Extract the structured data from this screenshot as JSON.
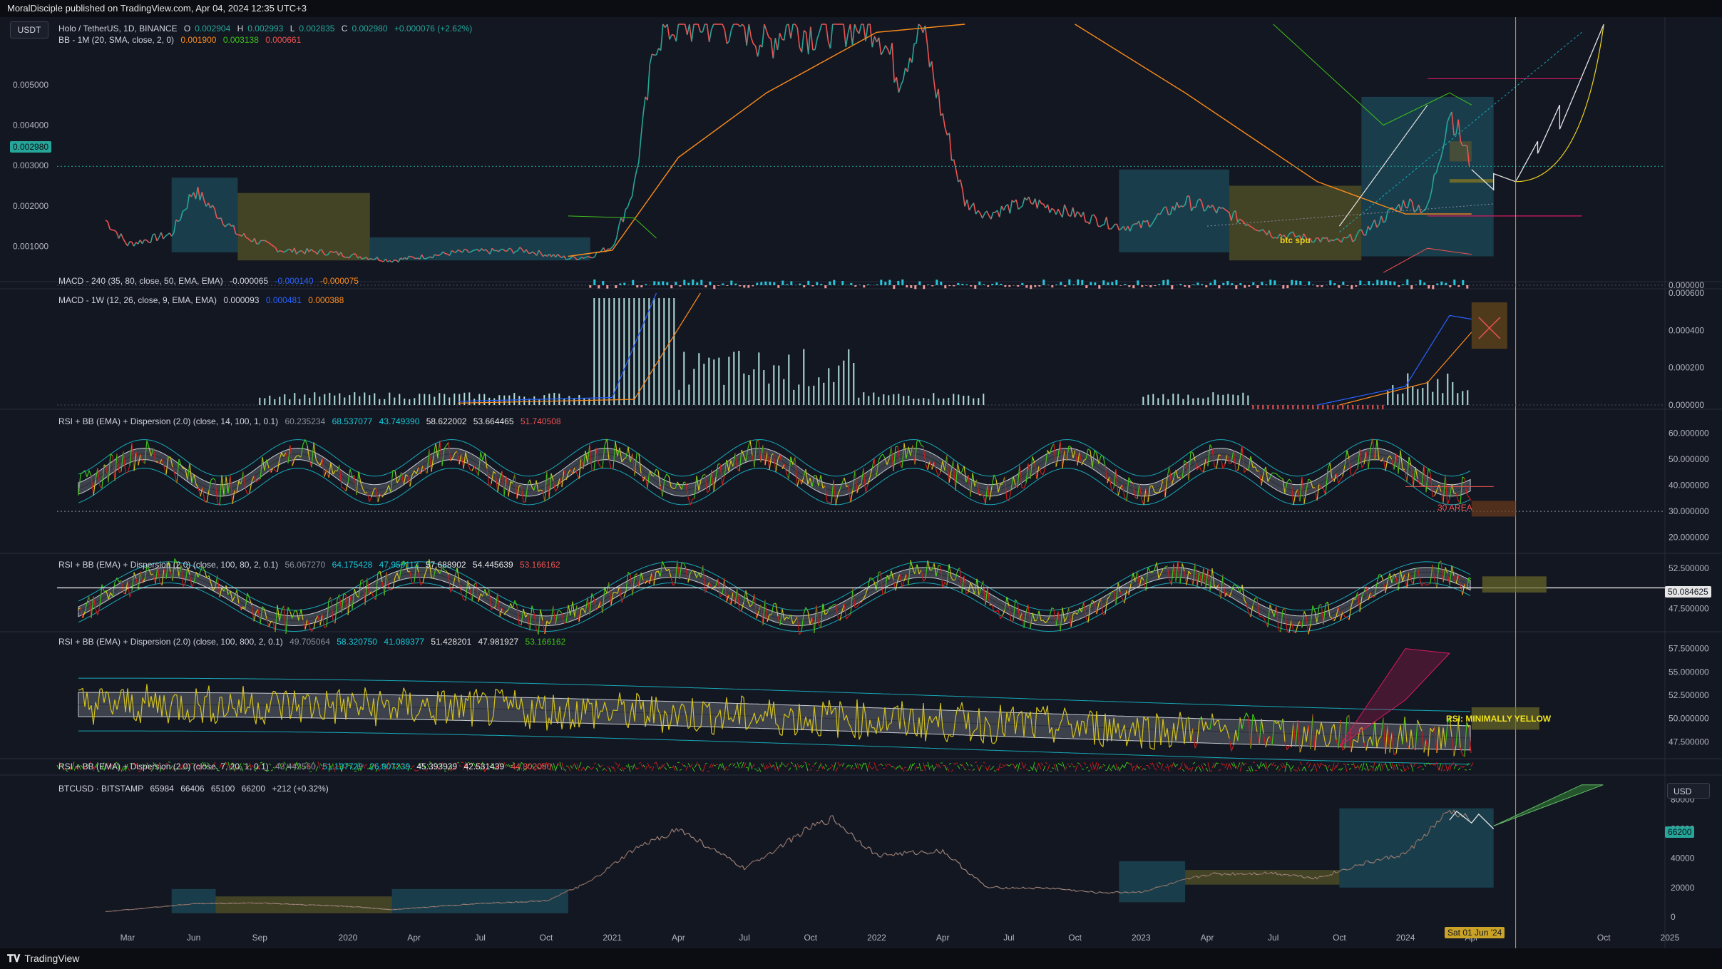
{
  "header": {
    "publisher": "MoralDisciple published on TradingView.com, Apr 04, 2024 12:35 UTC+3"
  },
  "footer": {
    "brand": "TradingView"
  },
  "currency_button": "USDT",
  "btc_currency_button": "USD",
  "legends": {
    "main": {
      "symbol": "Holo / TetherUS, 1D, BINANCE",
      "o_label": "O",
      "o": "0.002904",
      "h_label": "H",
      "h": "0.002993",
      "l_label": "L",
      "l": "0.002835",
      "c_label": "C",
      "c": "0.002980",
      "change": "+0.000076 (+2.62%)"
    },
    "bb": {
      "name": "BB - 1M (20, SMA, close, 2, 0)",
      "v1": "0.001900",
      "v2": "0.003138",
      "v3": "0.000661"
    },
    "macd240": {
      "name": "MACD - 240 (35, 80, close, 50, EMA, EMA)",
      "v1": "-0.000065",
      "v2": "-0.000140",
      "v3": "-0.000075"
    },
    "macd1w": {
      "name": "MACD - 1W (12, 26, close, 9, EMA, EMA)",
      "v1": "0.000093",
      "v2": "0.000481",
      "v3": "0.000388"
    },
    "rsi1": {
      "name": "RSI + BB (EMA) + Dispersion (2.0) (close, 14, 100, 1, 0.1)",
      "v0": "60.235234",
      "v1": "68.537077",
      "v2": "43.749390",
      "v3": "58.622002",
      "v4": "53.664465",
      "v5": "51.740508"
    },
    "rsi2": {
      "name": "RSI + BB (EMA) + Dispersion (2.0) (close, 100, 80, 2, 0.1)",
      "v0": "56.067270",
      "v1": "64.175428",
      "v2": "47.959113",
      "v3": "57.688902",
      "v4": "54.445639",
      "v5": "53.166162"
    },
    "rsi3": {
      "name": "RSI + BB (EMA) + Dispersion (2.0) (close, 100, 800, 2, 0.1)",
      "v0": "49.705064",
      "v1": "58.320750",
      "v2": "41.089377",
      "v3": "51.428201",
      "v4": "47.981927",
      "v5": "53.166162"
    },
    "rsi4": {
      "name": "RSI + BB (EMA) + Dispersion (2.0) (close, 7, 20, 1, 0.1)",
      "v0": "43.442560",
      "v1": "51.137729",
      "v2": "26.807239",
      "v3": "45.393939",
      "v4": "42.531439",
      "v5": "44.802080"
    },
    "btc": {
      "name": "BTCUSD · BITSTAMP",
      "o": "65984",
      "h": "66406",
      "l": "65100",
      "c": "66200",
      "change": "+212 (+0.32%)"
    }
  },
  "annotations": {
    "btc_spu": "btc spu",
    "area_30": "30 AREA",
    "rsi_note": "RSI: MINIMALLY YELLOW"
  },
  "price_labels": {
    "current": "0.002980",
    "rsi2_line": "50.084625",
    "btc_current": "66200",
    "date_cursor": "Sat 01 Jun '24"
  },
  "colors": {
    "background": "#131722",
    "candle_up": "#26a69a",
    "candle_down": "#ef5350",
    "rsi_yellow": "#d4c21c",
    "rsi_green": "#3fc21a",
    "rsi_red": "#c81d1d",
    "bb_band": "#8a8f99",
    "bb_cyan": "#17a9b8",
    "macd_blue": "#2962ff",
    "macd_orange": "#ff8c1a",
    "box_teal": "#1f5d6d",
    "box_olive": "#6b6a2a",
    "cursor": "#c9a227"
  },
  "chart_data": [
    {
      "type": "line",
      "pane": "Holo / TetherUS 1D",
      "y_axis_ticks": [
        "0.005000",
        "0.004000",
        "0.003000",
        "0.002000",
        "0.001000"
      ],
      "ylim": [
        0.0003,
        0.0065
      ],
      "x": [
        "2019-02",
        "2019-03",
        "2019-05",
        "2019-06",
        "2019-08",
        "2019-10",
        "2019-12",
        "2020-03",
        "2020-06",
        "2020-09",
        "2020-11",
        "2020-12",
        "2021-01",
        "2021-02",
        "2021-03",
        "2021-04",
        "2021-05",
        "2021-06",
        "2021-07",
        "2021-08",
        "2021-09",
        "2021-10",
        "2021-11",
        "2021-12",
        "2022-01",
        "2022-02",
        "2022-03",
        "2022-04",
        "2022-05",
        "2022-06",
        "2022-08",
        "2022-10",
        "2022-12",
        "2023-01",
        "2023-03",
        "2023-05",
        "2023-07",
        "2023-08",
        "2023-10",
        "2023-11",
        "2023-12",
        "2024-01",
        "2024-02",
        "2024-03",
        "2024-04"
      ],
      "series": [
        {
          "values": [
            0.00165,
            0.00105,
            0.0013,
            0.0024,
            0.0013,
            0.0009,
            0.00085,
            0.00065,
            0.00085,
            0.0009,
            0.0007,
            0.00075,
            0.001,
            0.0025,
            0.0062,
            0.0065,
            0.0065,
            0.0065,
            0.0065,
            0.006,
            0.0065,
            0.0063,
            0.0065,
            0.0065,
            0.0065,
            0.0052,
            0.0065,
            0.0042,
            0.0021,
            0.0018,
            0.0021,
            0.0018,
            0.0015,
            0.0015,
            0.0021,
            0.0018,
            0.0013,
            0.00125,
            0.0011,
            0.0013,
            0.0017,
            0.0021,
            0.0019,
            0.0044,
            0.00298
          ]
        }
      ]
    },
    {
      "type": "line",
      "pane": "BTCUSD · BITSTAMP",
      "y_axis_ticks": [
        "80000",
        "60000",
        "40000",
        "20000",
        "0"
      ],
      "ylim": [
        0,
        85000
      ],
      "x": [
        "2019-02",
        "2019-06",
        "2019-09",
        "2020-01",
        "2020-03",
        "2020-07",
        "2020-10",
        "2020-12",
        "2021-02",
        "2021-04",
        "2021-07",
        "2021-10",
        "2021-11",
        "2022-01",
        "2022-04",
        "2022-06",
        "2022-09",
        "2022-11",
        "2023-01",
        "2023-04",
        "2023-07",
        "2023-09",
        "2023-11",
        "2024-01",
        "2024-03",
        "2024-04"
      ],
      "series": [
        {
          "values": [
            3600,
            9000,
            9500,
            7200,
            5000,
            9200,
            11000,
            24000,
            46000,
            60000,
            33000,
            61000,
            67000,
            42000,
            45000,
            20000,
            19500,
            16500,
            17000,
            29000,
            30000,
            26500,
            36000,
            43000,
            72000,
            66200
          ]
        }
      ]
    }
  ],
  "x_axis_labels": [
    "Mar",
    "Jun",
    "Sep",
    "2020",
    "Apr",
    "Jul",
    "Oct",
    "2021",
    "Apr",
    "Jul",
    "Oct",
    "2022",
    "Apr",
    "Jul",
    "Oct",
    "2023",
    "Apr",
    "Jul",
    "Oct",
    "2024",
    "Apr",
    "Oct",
    "2025"
  ],
  "macd240_ticks": [
    "0.000000"
  ],
  "macd1w_ticks": [
    "0.000600",
    "0.000400",
    "0.000200",
    "0.000000"
  ],
  "rsi1_ticks": [
    "60.000000",
    "50.000000",
    "40.000000",
    "30.000000",
    "20.000000"
  ],
  "rsi2_ticks": [
    "52.500000",
    "47.500000"
  ],
  "rsi3_ticks": [
    "57.500000",
    "55.000000",
    "52.500000",
    "50.000000",
    "47.500000"
  ]
}
